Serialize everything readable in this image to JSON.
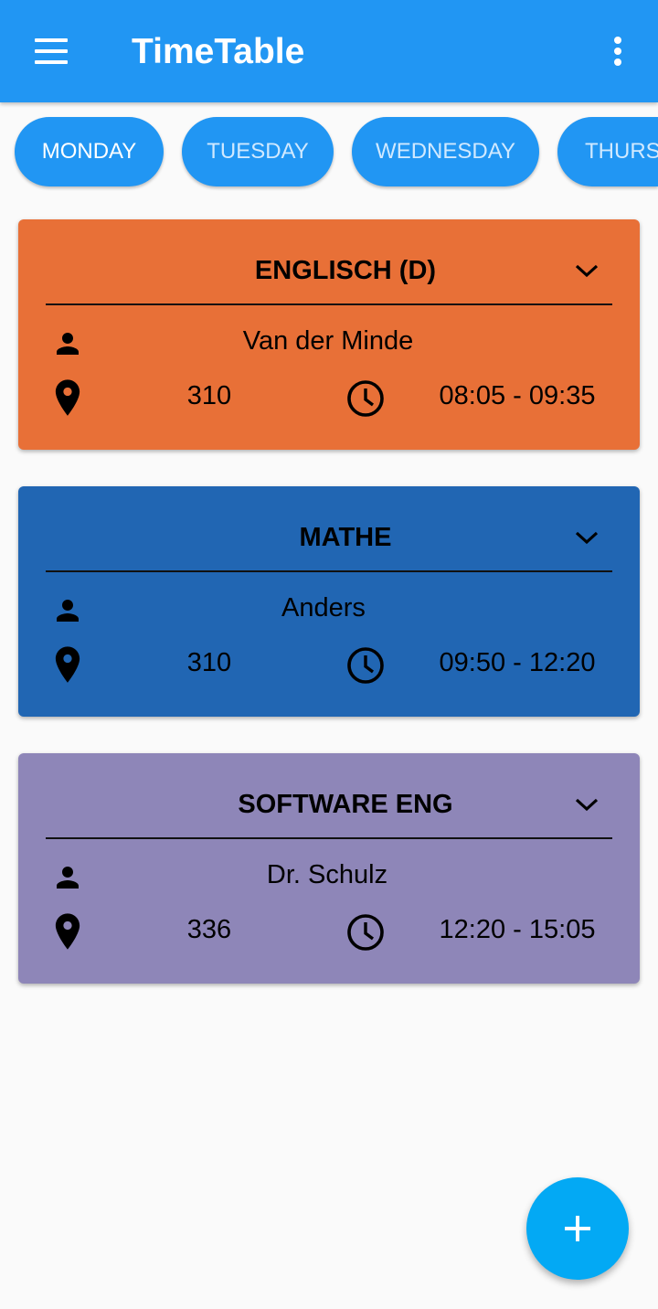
{
  "app_bar": {
    "title": "TimeTable",
    "menu_icon": "hamburger-menu-icon",
    "overflow_icon": "more-vert-icon",
    "color": "#2196f3"
  },
  "day_tabs": [
    {
      "label": "MONDAY",
      "selected": true
    },
    {
      "label": "TUESDAY",
      "selected": false
    },
    {
      "label": "WEDNESDAY",
      "selected": false
    },
    {
      "label": "THURS",
      "selected": false
    }
  ],
  "classes": [
    {
      "subject": "ENGLISCH (D)",
      "teacher": "Van der Minde",
      "room": "310",
      "time": "08:05 - 09:35",
      "color": "#e87037"
    },
    {
      "subject": "MATHE",
      "teacher": "Anders",
      "room": "310",
      "time": "09:50 - 12:20",
      "color": "#2166b3"
    },
    {
      "subject": "SOFTWARE ENG",
      "teacher": "Dr. Schulz",
      "room": "336",
      "time": "12:20 - 15:05",
      "color": "#8e86b8"
    }
  ],
  "fab": {
    "icon": "plus-icon",
    "color": "#03a9f4"
  }
}
